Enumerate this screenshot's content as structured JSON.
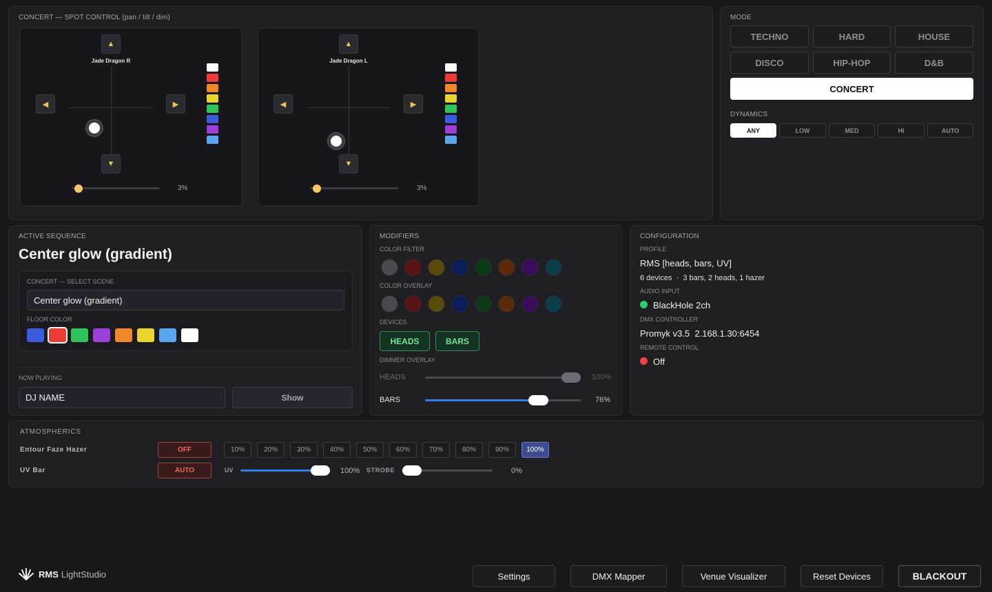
{
  "colors": {
    "accent_blue": "#2d7ff0",
    "active_mode_bg": "#ffffff",
    "device_green": "#6fe398",
    "status_green": "#2bd26b",
    "status_red": "#ef4444",
    "warn_red": "#f06a58",
    "arrow_yellow": "#f1c24e"
  },
  "spot": {
    "section_label": "CONCERT — SPOT CONTROL (pan / tilt / dim)",
    "fixtures": [
      {
        "name": "Jade Dragon R",
        "dim_value": "3%",
        "dim_level": 0.03,
        "color_swatches": [
          "#ffffff",
          "#ef3b35",
          "#f0872a",
          "#e8d42c",
          "#2fc35a",
          "#3b5bdc",
          "#9c3fd8",
          "#5aa6f0"
        ]
      },
      {
        "name": "Jade Dragon L",
        "dim_value": "3%",
        "dim_level": 0.03,
        "color_swatches": [
          "#ffffff",
          "#ef3b35",
          "#f0872a",
          "#e8d42c",
          "#2fc35a",
          "#3b5bdc",
          "#9c3fd8",
          "#5aa6f0"
        ]
      }
    ],
    "arrow_icons": {
      "up": "▲",
      "down": "▼",
      "left": "◀",
      "right": "▶"
    }
  },
  "mode": {
    "section_label": "MODE",
    "buttons": [
      "TECHNO",
      "HARD",
      "HOUSE",
      "DISCO",
      "HIP-HOP",
      "D&B"
    ],
    "active_button": "CONCERT",
    "dynamics_label": "DYNAMICS",
    "dynamics": [
      "ANY",
      "LOW",
      "MED",
      "HI",
      "AUTO"
    ],
    "active_dynamic": "ANY"
  },
  "sequence": {
    "section_label": "ACTIVE SEQUENCE",
    "title": "Center glow (gradient)",
    "scene_label": "CONCERT — SELECT SCENE",
    "scene_value": "Center glow (gradient)",
    "floor_label": "FLOOR COLOR",
    "floor_colors": [
      "#3b5bdc",
      "#ef3b35",
      "#2fc35a",
      "#9c3fd8",
      "#f0872a",
      "#e8d42c",
      "#5aa6f0",
      "#ffffff"
    ],
    "floor_selected_index": 1,
    "now_playing_label": "NOW PLAYING",
    "now_playing_value": "DJ NAME",
    "show_button": "Show"
  },
  "modifiers": {
    "section_label": "MODIFIERS",
    "color_filter_label": "COLOR FILTER",
    "color_overlay_label": "COLOR OVERLAY",
    "dot_colors": [
      "#4a4a4e",
      "#5a1414",
      "#5a4a0a",
      "#0c1e5a",
      "#0c3a18",
      "#5a2a0a",
      "#3a0c5a",
      "#0c3e4a"
    ],
    "devices_label": "DEVICES",
    "devices": [
      "HEADS",
      "BARS"
    ],
    "dimmer_label": "DIMMER OVERLAY",
    "dimmers": [
      {
        "name": "HEADS",
        "value": "100%",
        "level": 1.0,
        "enabled": false
      },
      {
        "name": "BARS",
        "value": "76%",
        "level": 0.76,
        "enabled": true
      }
    ]
  },
  "config": {
    "section_label": "CONFIGURATION",
    "profile_label": "PROFILE",
    "profile_value": "RMS [heads, bars, UV]",
    "devices_summary": "6 devices  ·  3 bars, 2 heads, 1 hazer",
    "audio_label": "AUDIO INPUT",
    "audio_value": "BlackHole 2ch",
    "dmx_label": "DMX CONTROLLER",
    "dmx_value": "Promyk v3.5  2.168.1.30:6454",
    "remote_label": "REMOTE CONTROL",
    "remote_value": "Off"
  },
  "atmospherics": {
    "section_label": "ATMOSPHERICS",
    "hazer": {
      "name": "Entour Faze Hazer",
      "state": "OFF",
      "levels": [
        "10%",
        "20%",
        "30%",
        "40%",
        "50%",
        "60%",
        "70%",
        "80%",
        "90%",
        "100%"
      ],
      "active_level": "100%"
    },
    "uv": {
      "name": "UV Bar",
      "state": "AUTO",
      "uv_label": "UV",
      "uv_value": "100%",
      "uv_level": 1.0,
      "strobe_label": "STROBE",
      "strobe_value": "0%",
      "strobe_level": 0.0
    }
  },
  "footer": {
    "brand_bold": "RMS",
    "brand_light": "LightStudio",
    "buttons": [
      "Settings",
      "DMX Mapper",
      "Venue Visualizer",
      "Reset Devices"
    ],
    "blackout": "BLACKOUT"
  }
}
